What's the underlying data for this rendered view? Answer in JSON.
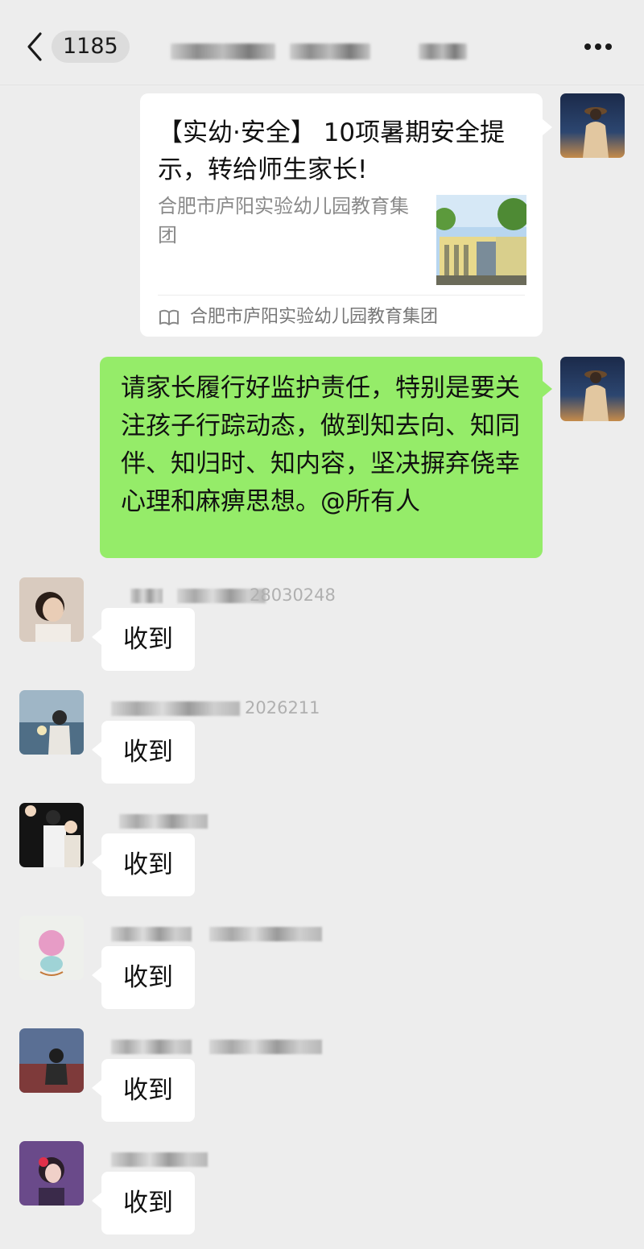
{
  "header": {
    "unread_count": "1185",
    "back_icon": "chevron-left-icon",
    "more_icon": "more-dots-icon"
  },
  "messages": {
    "article": {
      "title": "【实幼·安全】 10项暑期安全提示，转给师生家长!",
      "source": "合肥市庐阳实验幼儿园教育集团",
      "account": "合肥市庐阳实验幼儿园教育集团",
      "account_icon": "official-account-book-icon"
    },
    "notice": {
      "text": "请家长履行好监护责任，特别是要关注孩子行踪动态，做到知去向、知同伴、知归时、知内容，坚决摒弃侥幸心理和麻痹思想。@所有人"
    },
    "replies": [
      {
        "sender_tail": "28030248",
        "text": "收到"
      },
      {
        "sender_tail": "2026211",
        "text": "收到"
      },
      {
        "sender_tail": "",
        "text": "收到"
      },
      {
        "sender_tail": "",
        "text": "收到"
      },
      {
        "sender_tail": "",
        "text": "收到"
      },
      {
        "sender_tail": "",
        "text": "收到"
      }
    ]
  },
  "colors": {
    "background": "#ededed",
    "self_bubble": "#95ec69",
    "other_bubble": "#ffffff"
  }
}
